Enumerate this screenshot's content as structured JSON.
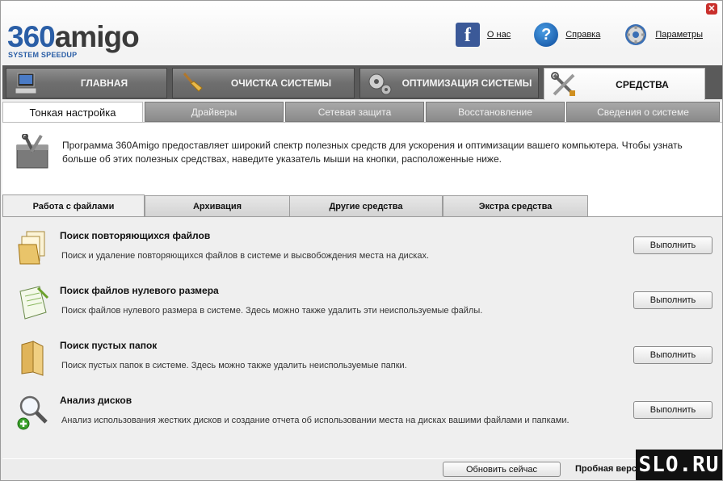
{
  "logo": {
    "main_prefix": "360",
    "main_suffix": "amigo",
    "sub": "SYSTEM SPEEDUP"
  },
  "toplinks": {
    "about": "О нас",
    "help": "Справка",
    "settings": "Параметры"
  },
  "main_tabs": [
    {
      "label": "ГЛАВНАЯ"
    },
    {
      "label": "ОЧИСТКА СИСТЕМЫ"
    },
    {
      "label": "ОПТИМИЗАЦИЯ СИСТЕМЫ"
    },
    {
      "label": "СРЕДСТВА"
    }
  ],
  "sub_tabs": [
    {
      "label": "Тонкая настройка"
    },
    {
      "label": "Драйверы"
    },
    {
      "label": "Сетевая защита"
    },
    {
      "label": "Восстановление"
    },
    {
      "label": "Сведения о системе"
    }
  ],
  "intro": "Программа 360Amigo предоставляет широкий спектр полезных средств для ускорения и оптимизации вашего компьютера. Чтобы узнать больше об этих полезных средствах, наведите указатель мыши на кнопки, расположенные ниже.",
  "inner_tabs": [
    {
      "label": "Работа с файлами"
    },
    {
      "label": "Архивация"
    },
    {
      "label": "Другие средства"
    },
    {
      "label": "Экстра средства"
    }
  ],
  "tools": [
    {
      "name": "Поиск повторяющихся файлов",
      "desc": "Поиск и удаление повторяющихся файлов в системе и высвобождения места на дисках.",
      "button": "Выполнить"
    },
    {
      "name": "Поиск файлов нулевого размера",
      "desc": "Поиск файлов нулевого размера в системе. Здесь можно также удалить эти неиспользуемые файлы.",
      "button": "Выполнить"
    },
    {
      "name": "Поиск пустых папок",
      "desc": "Поиск пустых папок в системе. Здесь можно также удалить неиспользуемые папки.",
      "button": "Выполнить"
    },
    {
      "name": "Анализ дисков",
      "desc": "Анализ использования жестких дисков и создание отчета об использовании места на дисках вашими файлами и папками.",
      "button": "Выполнить"
    }
  ],
  "status": {
    "update_button": "Обновить сейчас",
    "version": "Пробная версия"
  },
  "watermark": "SLO.RU",
  "colors": {
    "brand_blue": "#2a5ea6",
    "tab_dark": "#5a5a5a",
    "panel_bg": "#efefef",
    "close_red": "#c9302c"
  }
}
